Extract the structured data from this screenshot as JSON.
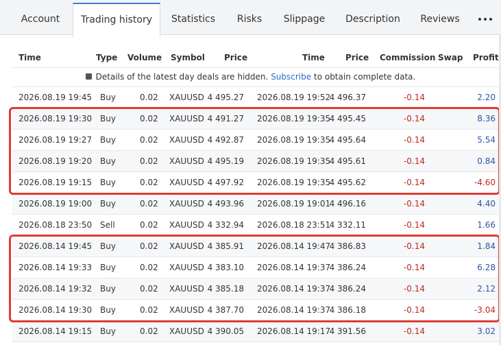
{
  "tabs": [
    {
      "label": "Account",
      "active": false
    },
    {
      "label": "Trading history",
      "active": true
    },
    {
      "label": "Statistics",
      "active": false
    },
    {
      "label": "Risks",
      "active": false
    },
    {
      "label": "Slippage",
      "active": false
    },
    {
      "label": "Description",
      "active": false
    },
    {
      "label": "Reviews",
      "active": false
    }
  ],
  "more_icon": "more-dots-icon",
  "columns": {
    "open_time": "Time",
    "type": "Type",
    "volume": "Volume",
    "symbol": "Symbol",
    "open_price": "Price",
    "close_time": "Time",
    "close_price": "Price",
    "commission": "Commission",
    "swap": "Swap",
    "profit": "Profit"
  },
  "notice": {
    "icon": "lock-icon",
    "text_before": "Details of the latest day deals are hidden.",
    "link": "Subscribe",
    "text_after": "to obtain complete data."
  },
  "rows": [
    {
      "open_time": "2026.08.19 19:45",
      "type": "Buy",
      "volume": "0.02",
      "symbol": "XAUUSD",
      "open_price": "4 495.27",
      "close_time": "2026.08.19 19:52",
      "close_price": "4 496.37",
      "commission": "-0.14",
      "swap": "",
      "profit": "2.20"
    },
    {
      "open_time": "2026.08.19 19:30",
      "type": "Buy",
      "volume": "0.02",
      "symbol": "XAUUSD",
      "open_price": "4 491.27",
      "close_time": "2026.08.19 19:35",
      "close_price": "4 495.45",
      "commission": "-0.14",
      "swap": "",
      "profit": "8.36"
    },
    {
      "open_time": "2026.08.19 19:27",
      "type": "Buy",
      "volume": "0.02",
      "symbol": "XAUUSD",
      "open_price": "4 492.87",
      "close_time": "2026.08.19 19:35",
      "close_price": "4 495.64",
      "commission": "-0.14",
      "swap": "",
      "profit": "5.54"
    },
    {
      "open_time": "2026.08.19 19:20",
      "type": "Buy",
      "volume": "0.02",
      "symbol": "XAUUSD",
      "open_price": "4 495.19",
      "close_time": "2026.08.19 19:35",
      "close_price": "4 495.61",
      "commission": "-0.14",
      "swap": "",
      "profit": "0.84"
    },
    {
      "open_time": "2026.08.19 19:15",
      "type": "Buy",
      "volume": "0.02",
      "symbol": "XAUUSD",
      "open_price": "4 497.92",
      "close_time": "2026.08.19 19:35",
      "close_price": "4 495.62",
      "commission": "-0.14",
      "swap": "",
      "profit": "-4.60"
    },
    {
      "open_time": "2026.08.19 19:00",
      "type": "Buy",
      "volume": "0.02",
      "symbol": "XAUUSD",
      "open_price": "4 493.96",
      "close_time": "2026.08.19 19:01",
      "close_price": "4 496.16",
      "commission": "-0.14",
      "swap": "",
      "profit": "4.40"
    },
    {
      "open_time": "2026.08.18 23:50",
      "type": "Sell",
      "volume": "0.02",
      "symbol": "XAUUSD",
      "open_price": "4 332.94",
      "close_time": "2026.08.18 23:51",
      "close_price": "4 332.11",
      "commission": "-0.14",
      "swap": "",
      "profit": "1.66"
    },
    {
      "open_time": "2026.08.14 19:45",
      "type": "Buy",
      "volume": "0.02",
      "symbol": "XAUUSD",
      "open_price": "4 385.91",
      "close_time": "2026.08.14 19:47",
      "close_price": "4 386.83",
      "commission": "-0.14",
      "swap": "",
      "profit": "1.84"
    },
    {
      "open_time": "2026.08.14 19:33",
      "type": "Buy",
      "volume": "0.02",
      "symbol": "XAUUSD",
      "open_price": "4 383.10",
      "close_time": "2026.08.14 19:37",
      "close_price": "4 386.24",
      "commission": "-0.14",
      "swap": "",
      "profit": "6.28"
    },
    {
      "open_time": "2026.08.14 19:32",
      "type": "Buy",
      "volume": "0.02",
      "symbol": "XAUUSD",
      "open_price": "4 385.18",
      "close_time": "2026.08.14 19:37",
      "close_price": "4 386.24",
      "commission": "-0.14",
      "swap": "",
      "profit": "2.12"
    },
    {
      "open_time": "2026.08.14 19:30",
      "type": "Buy",
      "volume": "0.02",
      "symbol": "XAUUSD",
      "open_price": "4 387.70",
      "close_time": "2026.08.14 19:37",
      "close_price": "4 386.18",
      "commission": "-0.14",
      "swap": "",
      "profit": "-3.04"
    },
    {
      "open_time": "2026.08.14 19:15",
      "type": "Buy",
      "volume": "0.02",
      "symbol": "XAUUSD",
      "open_price": "4 390.05",
      "close_time": "2026.08.14 19:17",
      "close_price": "4 391.56",
      "commission": "-0.14",
      "swap": "",
      "profit": "3.02"
    }
  ],
  "highlight_groups": [
    {
      "first_row": 1,
      "last_row": 4
    },
    {
      "first_row": 7,
      "last_row": 10
    }
  ],
  "colors": {
    "positive_profit": "#2c55a8",
    "negative_value": "#c0281f",
    "highlight_border": "#e03b35",
    "active_tab_accent": "#3b7bd4",
    "link": "#2b6cc4"
  }
}
